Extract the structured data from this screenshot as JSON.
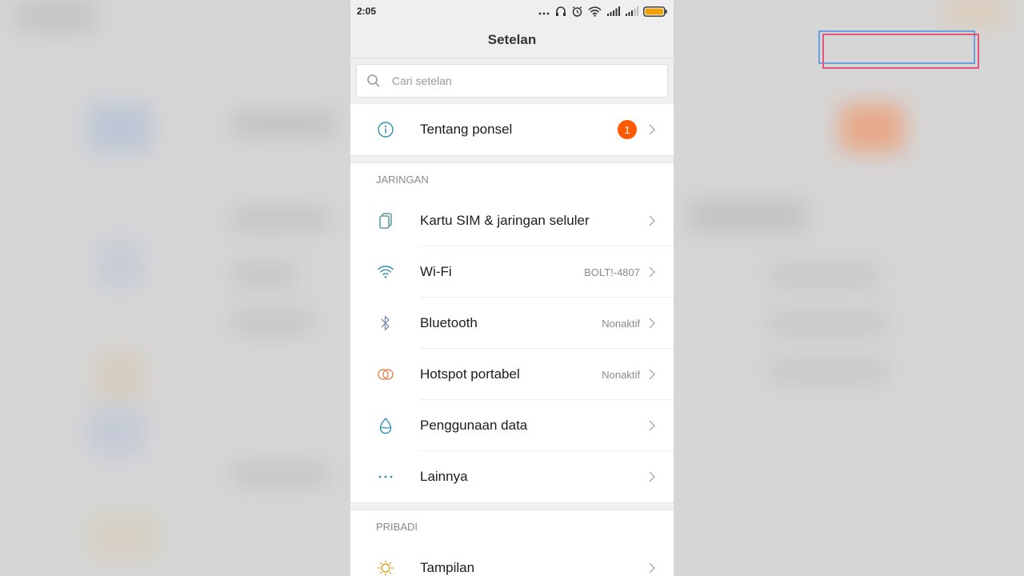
{
  "status_bar": {
    "time": "2:05"
  },
  "header": {
    "title": "Setelan"
  },
  "search": {
    "placeholder": "Cari setelan"
  },
  "about": {
    "label": "Tentang ponsel",
    "badge": "1"
  },
  "sections": {
    "network_title": "JARINGAN",
    "personal_title": "PRIBADI"
  },
  "network_items": [
    {
      "label": "Kartu SIM & jaringan seluler",
      "value": ""
    },
    {
      "label": "Wi-Fi",
      "value": "BOLT!-4807"
    },
    {
      "label": "Bluetooth",
      "value": "Nonaktif"
    },
    {
      "label": "Hotspot portabel",
      "value": "Nonaktif"
    },
    {
      "label": "Penggunaan data",
      "value": ""
    },
    {
      "label": "Lainnya",
      "value": ""
    }
  ],
  "personal_items": [
    {
      "label": "Tampilan",
      "value": ""
    }
  ],
  "colors": {
    "accent_badge": "#ff5a00",
    "icon_teal": "#2f8fb5",
    "icon_orange": "#e08a5a"
  }
}
